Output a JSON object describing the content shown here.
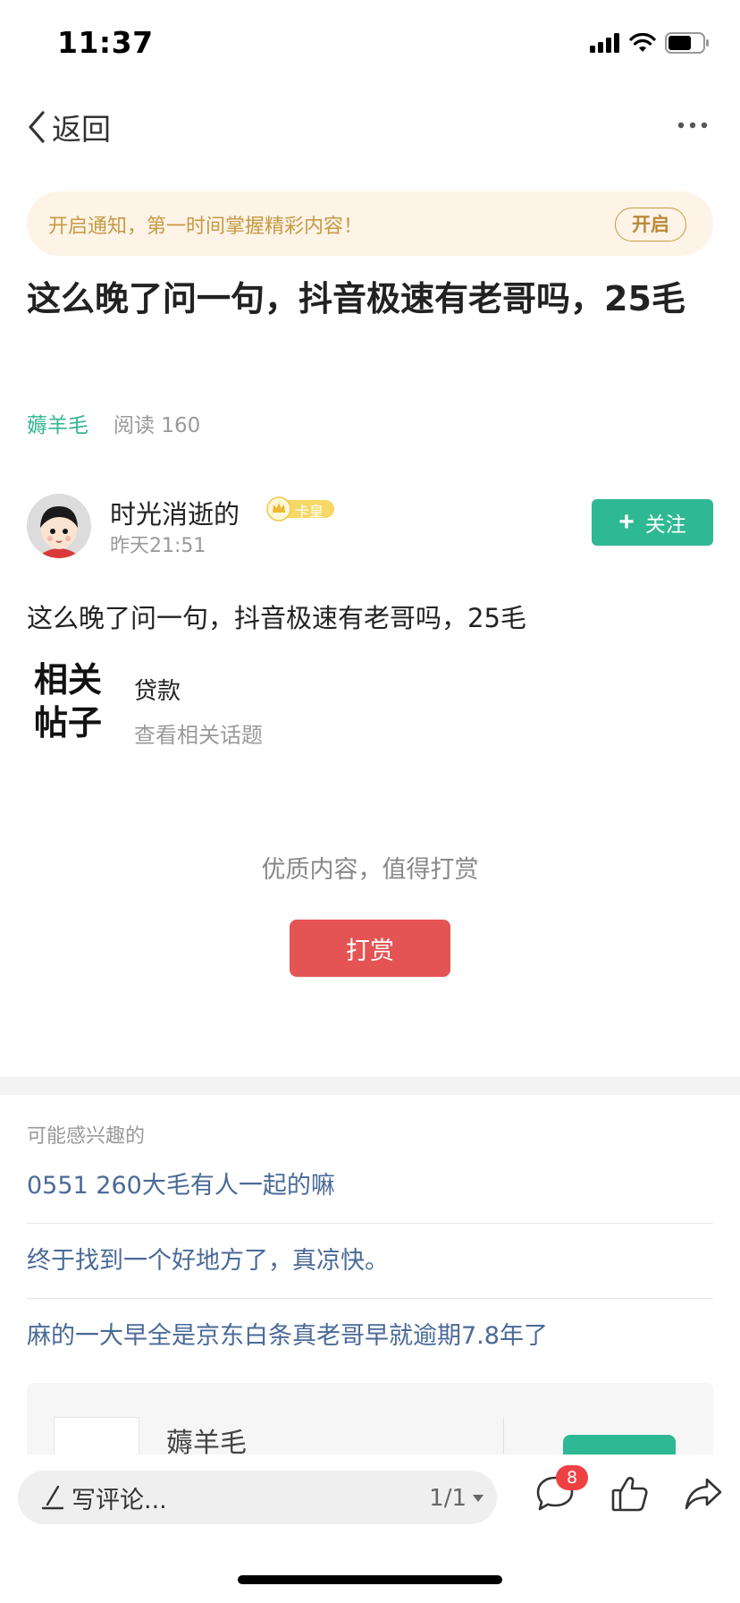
{
  "status_bar": {
    "time": "11:37"
  },
  "nav": {
    "back_label": "返回"
  },
  "notice": {
    "text": "开启通知，第一时间掌握精彩内容！",
    "button_label": "开启"
  },
  "post": {
    "title": "这么晚了问一句，抖音极速有老哥吗，25毛",
    "tag": "薅羊毛",
    "read_count": "阅读 160",
    "body": "这么晚了问一句，抖音极速有老哥吗，25毛"
  },
  "author": {
    "name": "时光消逝的",
    "badge_text": "卡皇",
    "time": "昨天21:51",
    "follow_label": "关注"
  },
  "related": {
    "label": "相关帖子",
    "topic": "贷款",
    "more_label": "查看相关话题"
  },
  "reward": {
    "hint": "优质内容，值得打赏",
    "button_label": "打赏"
  },
  "interest": {
    "label": "可能感兴趣的",
    "items": [
      "0551 260大毛有人一起的嘛",
      "终于找到一个好地方了，真凉快。",
      "麻的一大早全是京东白条真老哥早就逾期7.8年了"
    ]
  },
  "card": {
    "name": "薅羊毛"
  },
  "bottom_bar": {
    "comment_placeholder": "写评论...",
    "page_indicator": "1/1",
    "comment_count": "8"
  },
  "colors": {
    "accent_green": "#2fb894",
    "reward_red": "#e55454",
    "notice_bg": "#fdf3e6",
    "notice_text": "#c69a44",
    "link_blue": "#4a6a97"
  },
  "icons": [
    "signal-icon",
    "wifi-icon",
    "battery-icon",
    "back-chevron-icon",
    "more-dots-icon",
    "crown-icon",
    "plus-icon",
    "pen-icon",
    "caret-down-icon",
    "comment-icon",
    "thumb-up-icon",
    "share-icon"
  ]
}
